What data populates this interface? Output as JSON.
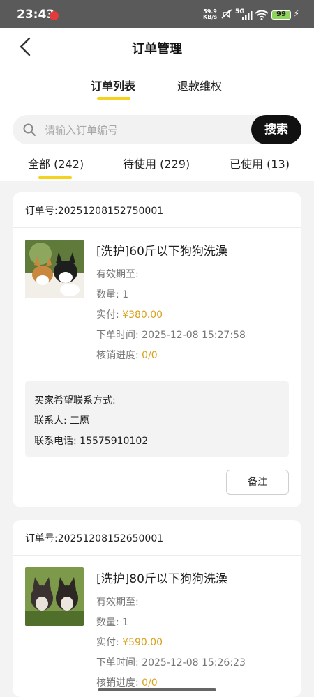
{
  "status": {
    "time": "23:43",
    "speed_value": "59.9",
    "speed_unit": "KB/s",
    "network": "5G",
    "battery": "99"
  },
  "nav": {
    "title": "订单管理"
  },
  "tabs": [
    {
      "label": "订单列表"
    },
    {
      "label": "退款维权"
    }
  ],
  "search": {
    "placeholder": "请输入订单编号",
    "button": "搜索"
  },
  "filters": [
    {
      "label": "全部 (242)"
    },
    {
      "label": "待使用 (229)"
    },
    {
      "label": "已使用 (13)"
    }
  ],
  "labels": {
    "valid_until": "有效期至:",
    "contact_header": "买家希望联系方式:",
    "note": "备注"
  },
  "orders": [
    {
      "order_no": "订单号:20251208152750001",
      "product": "[洗护]60斤以下狗狗洗澡",
      "qty": "数量: 1",
      "paid_label": "实付:",
      "paid": "¥380.00",
      "time": "下单时间: 2025-12-08 15:27:58",
      "progress_label": "核销进度:",
      "progress": "0/0",
      "contact_name": "联系人: 三愿",
      "contact_phone": "联系电话: 15575910102"
    },
    {
      "order_no": "订单号:20251208152650001",
      "product": "[洗护]80斤以下狗狗洗澡",
      "qty": "数量: 1",
      "paid_label": "实付:",
      "paid": "¥590.00",
      "time": "下单时间: 2025-12-08 15:26:23",
      "progress_label": "核销进度:",
      "progress": "0/0"
    }
  ],
  "colors": {
    "accent": "#f4d21e",
    "price": "#d9a11c",
    "search_button": "#111111"
  }
}
